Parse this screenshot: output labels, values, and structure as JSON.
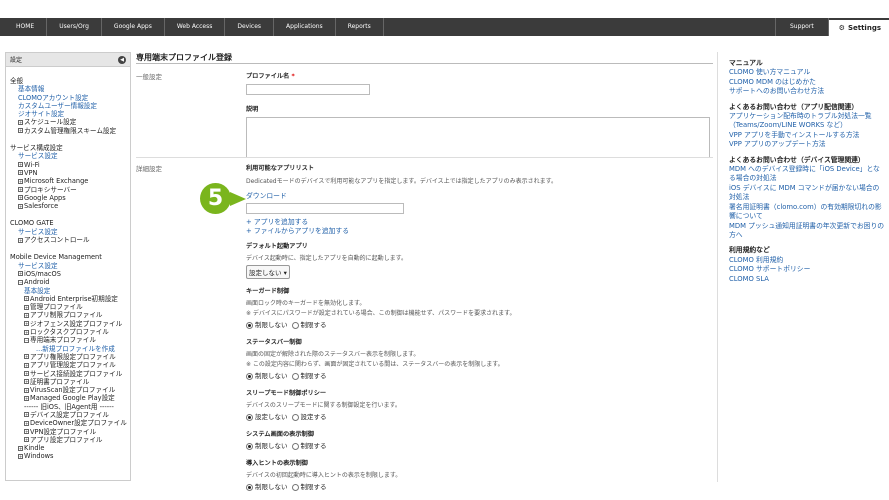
{
  "nav": {
    "items": [
      "HOME",
      "Users/Org",
      "Google Apps",
      "Web Access",
      "Devices",
      "Applications",
      "Reports"
    ],
    "support": "Support",
    "settings": "Settings"
  },
  "sidebar": {
    "header": "設定",
    "general": {
      "title": "全般",
      "links": [
        "基本情報",
        "CLOMOアカウント設定",
        "カスタムユーザー情報設定",
        "ジオサイト設定"
      ],
      "toggles": [
        "スケジュール設定",
        "カスタム管理権限スキーム設定"
      ]
    },
    "services": {
      "title": "サービス構成設定",
      "link": "サービス設定",
      "toggles": [
        "Wi-Fi",
        "VPN",
        "Microsoft Exchange",
        "プロキシサーバー",
        "Google Apps",
        "Salesforce"
      ]
    },
    "gate": {
      "title": "CLOMO GATE",
      "link": "サービス設定",
      "toggles": [
        "アクセスコントロール"
      ]
    },
    "mdm": {
      "title": "Mobile Device Management",
      "link": "サービス設定",
      "ios": "iOS/macOS",
      "android": "Android",
      "basic": "基本設定",
      "android_items": [
        "Android Enterprise初期設定",
        "管理プロファイル",
        "アプリ制限プロファイル",
        "ジオフェンス設定プロファイル",
        "ロックタスクプロファイル",
        "専用端末プロファイル"
      ],
      "new_profile": "...新規プロファイルを作成",
      "android_items2": [
        "アプリ権限設定プロファイル",
        "アプリ管理設定プロファイル",
        "サービス接続設定プロファイル",
        "証明書プロファイル",
        "VirusScan設定プロファイル",
        "Managed Google Play設定"
      ],
      "separator": "------ 旧iOS、旧Agent用 ------",
      "legacy_items": [
        "デバイス設定プロファイル",
        "DeviceOwner設定プロファイル",
        "VPN設定プロファイル",
        "アプリ設定プロファイル"
      ],
      "kindle": "Kindle",
      "windows": "Windows"
    }
  },
  "main": {
    "title": "専用端末プロファイル登録",
    "general_label": "一般設定",
    "detail_label": "詳細設定",
    "profile_name_label": "プロファイル名",
    "required_mark": "*",
    "description_label": "説明",
    "apps_label": "利用可能なアプリリスト",
    "apps_desc": "Dedicatedモードのデバイスで利用可能なアプリを指定します。デバイス上では指定したアプリのみ表示されます。",
    "download_link": "ダウンロード",
    "add_app": "+ アプリを追加する",
    "add_from_file": "+ ファイルからアプリを追加する",
    "default_app_label": "デフォルト起動アプリ",
    "default_app_desc": "デバイス起動時に、指定したアプリを自動的に起動します。",
    "default_app_select": "設定しない",
    "keyguard_label": "キーガード制御",
    "keyguard_desc1": "画面ロック時のキーガードを無効化します。",
    "keyguard_desc2": "※ デバイスにパスワードが設定されている場合、この制御は機能せず、パスワードを要求されます。",
    "statusbar_label": "ステータスバー制御",
    "statusbar_desc1": "画面の固定が解除された際のステータスバー表示を制限します。",
    "statusbar_desc2": "※ この設定内容に関わらず、画面が固定されている間は、ステータスバーの表示を制限します。",
    "sleep_label": "スリープモード制御ポリシー",
    "sleep_desc": "デバイスのスリープモードに関する制御設定を行います。",
    "system_label": "システム画面の表示制御",
    "intro_label": "導入ヒントの表示制御",
    "intro_desc": "デバイスの初回起動時に導入ヒントの表示を制限します。",
    "opt_no_limit": "制限しない",
    "opt_limit": "制限する",
    "opt_no_set": "設定しない",
    "opt_set": "設定する",
    "badge": "5"
  },
  "right": {
    "manual_head": "マニュアル",
    "manual_links": [
      "CLOMO 使い方マニュアル",
      "CLOMO MDM のはじめかた",
      "サポートへのお問い合わせ方法"
    ],
    "faq_app_head": "よくあるお問い合わせ（アプリ配信関連）",
    "faq_app_links": [
      "アプリケーション配布時のトラブル対処法一覧（Teams/Zoom/LINE WORKS など）",
      "VPP アプリを手動でインストールする方法",
      "VPP アプリのアップデート方法"
    ],
    "faq_dev_head": "よくあるお問い合わせ（デバイス管理関連）",
    "faq_dev_links": [
      "MDM へのデバイス登録時に「iOS Device」となる場合の対処法",
      "iOS デバイスに MDM コマンドが届かない場合の対処法",
      "署名用証明書（clomo.com）の有効期限切れの影響について",
      "MDM プッシュ通知用証明書の年次更新でお困りの方へ"
    ],
    "terms_head": "利用規約など",
    "terms_links": [
      "CLOMO 利用規約",
      "CLOMO サポートポリシー",
      "CLOMO SLA"
    ]
  }
}
